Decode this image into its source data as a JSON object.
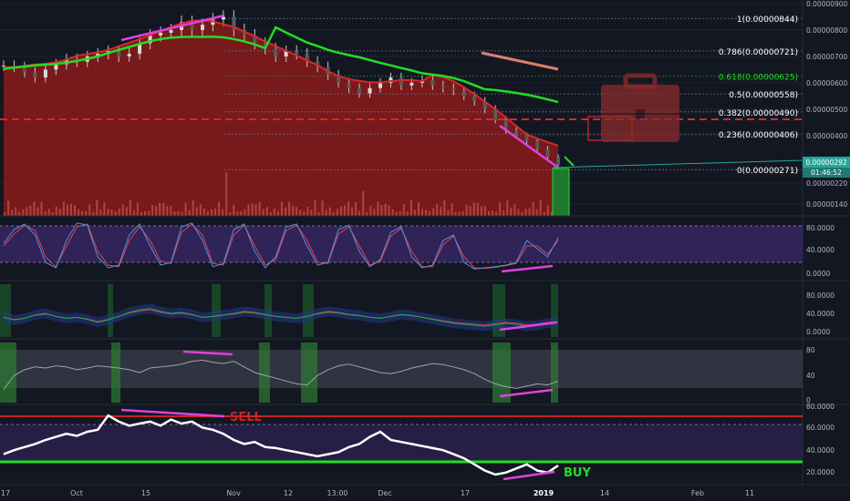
{
  "chart_data": [
    {
      "type": "candlestick",
      "panel": "price",
      "ylim": [
        1.2e-06,
        9e-06
      ],
      "y_ticks": [
        "0.00000900",
        "0.00000800",
        "0.00000700",
        "0.00000600",
        "0.00000500",
        "0.00000400",
        "0.00000220",
        "0.00000140"
      ],
      "fib_levels": [
        {
          "label": "1(0.00000844)",
          "value": 8.44e-06
        },
        {
          "label": "0.786(0.00000721)",
          "value": 7.21e-06
        },
        {
          "label": "0.618(0.00000625)",
          "value": 6.25e-06
        },
        {
          "label": "0.5(0.00000558)",
          "value": 5.58e-06
        },
        {
          "label": "0.382(0.00000490)",
          "value": 4.9e-06
        },
        {
          "label": "0.236(0.00000406)",
          "value": 4.06e-06
        },
        {
          "label": "0(0.00000271)",
          "value": 2.71e-06
        }
      ],
      "last_price_label": "0.00000292",
      "countdown_label": "01:46:52",
      "last_price": 2.92e-06,
      "close_series": [
        6.65e-06,
        6.6e-06,
        6.4e-06,
        6.2e-06,
        6.5e-06,
        6.7e-06,
        6.9e-06,
        6.8e-06,
        7e-06,
        7.1e-06,
        7.2e-06,
        7e-06,
        7.1e-06,
        7.5e-06,
        7.8e-06,
        7.9e-06,
        8e-06,
        8.3e-06,
        8e-06,
        8.2e-06,
        8.4e-06,
        8.5e-06,
        8e-06,
        7.8e-06,
        7.5e-06,
        7.3e-06,
        7e-06,
        7.2e-06,
        7.1e-06,
        6.8e-06,
        6.6e-06,
        6.3e-06,
        6e-06,
        5.8e-06,
        5.6e-06,
        5.8e-06,
        6e-06,
        6.2e-06,
        5.9e-06,
        6e-06,
        6.1e-06,
        5.9e-06,
        5.8e-06,
        5.7e-06,
        5.5e-06,
        5.3e-06,
        5e-06,
        4.6e-06,
        4.2e-06,
        4e-06,
        3.8e-06,
        3.5e-06,
        3.2e-06,
        2.9e-06
      ],
      "colors": {
        "background": "#131722",
        "ma_green": "#22dd22",
        "ma_red": "#cc2222",
        "fill_red": "#8b1a1a",
        "divergence": "#e040e0",
        "level_red": "#d42a2a",
        "price_badge": "#26a69a"
      },
      "icons": [
        "briefcase-icon"
      ]
    },
    {
      "type": "line",
      "panel": "stoch-rsi",
      "y_ticks": [
        "80.0000",
        "40.0000",
        "0.0000"
      ],
      "ylim": [
        0,
        100
      ],
      "series_k": [
        55,
        80,
        90,
        70,
        20,
        10,
        60,
        92,
        88,
        30,
        10,
        15,
        70,
        90,
        50,
        15,
        20,
        85,
        92,
        60,
        12,
        18,
        80,
        90,
        40,
        10,
        30,
        85,
        90,
        50,
        15,
        20,
        80,
        88,
        40,
        12,
        25,
        75,
        85,
        30,
        10,
        15,
        60,
        70,
        20,
        8,
        10,
        12,
        15,
        20,
        60,
        45,
        30,
        65
      ],
      "series_d": [
        50,
        72,
        88,
        78,
        30,
        12,
        50,
        85,
        90,
        40,
        15,
        12,
        60,
        85,
        60,
        22,
        18,
        75,
        90,
        70,
        18,
        15,
        70,
        88,
        50,
        15,
        25,
        78,
        88,
        60,
        20,
        18,
        72,
        85,
        50,
        15,
        22,
        68,
        82,
        40,
        12,
        12,
        52,
        68,
        30,
        10,
        9,
        11,
        14,
        18,
        50,
        50,
        35,
        60
      ]
    },
    {
      "type": "line",
      "panel": "oscillator-bands",
      "y_ticks": [
        "80.0000",
        "40.0000",
        "0.0000"
      ],
      "ylim": [
        0,
        100
      ],
      "series_main": [
        40,
        35,
        38,
        45,
        48,
        42,
        38,
        40,
        36,
        30,
        35,
        42,
        50,
        55,
        58,
        52,
        48,
        50,
        46,
        40,
        42,
        45,
        48,
        52,
        50,
        46,
        42,
        40,
        38,
        42,
        48,
        52,
        50,
        46,
        44,
        40,
        38,
        42,
        46,
        44,
        40,
        36,
        32,
        28,
        26,
        24,
        22,
        25,
        28,
        26,
        22,
        24,
        28,
        30
      ]
    },
    {
      "type": "line",
      "panel": "oscillator-2",
      "y_ticks": [
        "80",
        "40",
        "0"
      ],
      "ylim": [
        0,
        100
      ],
      "series_main": [
        20,
        45,
        55,
        60,
        58,
        62,
        60,
        55,
        58,
        62,
        60,
        58,
        55,
        50,
        58,
        60,
        62,
        65,
        70,
        72,
        68,
        66,
        70,
        60,
        50,
        45,
        40,
        35,
        30,
        28,
        45,
        55,
        62,
        65,
        60,
        55,
        50,
        48,
        52,
        58,
        62,
        66,
        64,
        60,
        55,
        48,
        38,
        30,
        25,
        22,
        26,
        30,
        28,
        35
      ]
    },
    {
      "type": "line",
      "panel": "rsi",
      "y_ticks": [
        "80.0000",
        "60.0000",
        "40.0000",
        "20.0000"
      ],
      "ylim": [
        10,
        85
      ],
      "series_main": [
        38,
        42,
        45,
        48,
        52,
        55,
        58,
        56,
        60,
        62,
        76,
        70,
        66,
        68,
        70,
        66,
        72,
        68,
        70,
        64,
        62,
        58,
        52,
        48,
        50,
        45,
        44,
        42,
        40,
        38,
        36,
        38,
        40,
        45,
        48,
        55,
        60,
        52,
        50,
        48,
        46,
        44,
        42,
        38,
        34,
        28,
        22,
        18,
        20,
        24,
        28,
        22,
        20,
        27
      ],
      "labels": {
        "sell": "SELL",
        "buy": "BUY"
      },
      "colors": {
        "line": "#ffffff",
        "overbought": "#cc2222",
        "oversold": "#22dd22",
        "fill": "#2a1f4a"
      }
    }
  ],
  "x_axis": {
    "tick_labels": [
      "17",
      "Oct",
      "15",
      "Nov",
      "12",
      "13:00",
      "Dec",
      "17",
      "2019",
      "14",
      "Feb",
      "11"
    ]
  }
}
